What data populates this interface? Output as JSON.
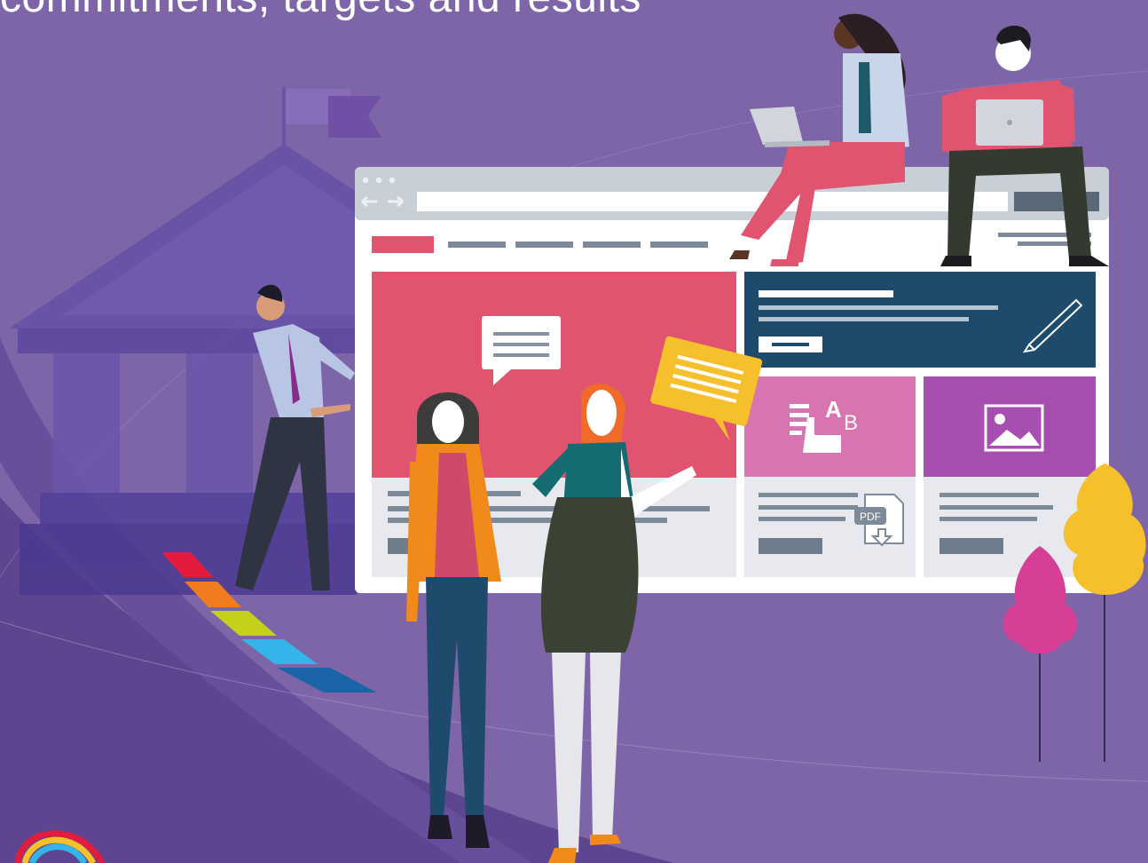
{
  "header": {
    "title": "commitments, targets and results"
  },
  "browser": {
    "icons": {
      "back": "arrow-left-icon",
      "forward": "arrow-right-icon",
      "edit": "pen-icon",
      "translate": "text-size-icon",
      "image": "image-icon",
      "pdf": "pdf-download-icon",
      "message": "chat-bubble-icon"
    },
    "pdf_label": "PDF",
    "text_size_label_large": "A",
    "text_size_label_small": "B"
  },
  "colors": {
    "background": "#7d65a8",
    "accent_red": "#e05470",
    "navy": "#1e4a6c",
    "pink": "#d874b0",
    "purple": "#a74fb0",
    "yellow": "#f6bf2c",
    "orange": "#f08a1a"
  }
}
